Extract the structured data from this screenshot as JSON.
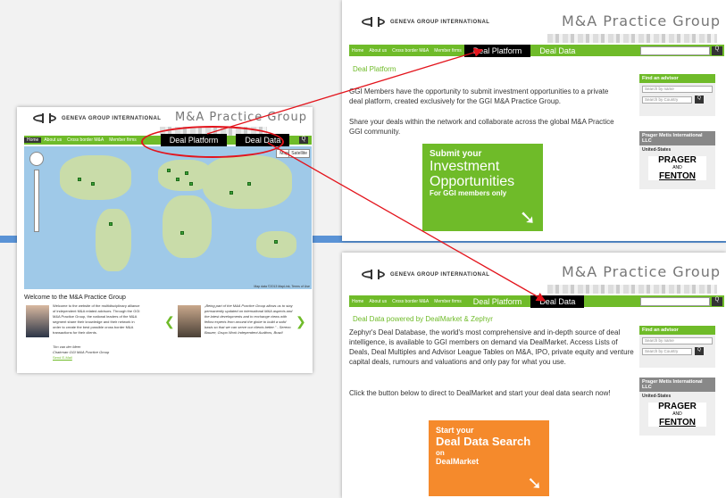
{
  "brand": {
    "logo_text": "GENEVA GROUP INTERNATIONAL",
    "site_title": "M&A Practice Group"
  },
  "nav": {
    "items": [
      "Home",
      "About us",
      "Cross border M&A",
      "Member firms"
    ],
    "deal_platform": "Deal Platform",
    "deal_data": "Deal Data",
    "map_tab": "Map",
    "satellite_tab": "Satellite"
  },
  "left": {
    "welcome_title": "Welcome to the M&A Practice Group",
    "welcome_body": "Welcome to the website of the multidisciplinary alliance of independent M&A related advisors. Through the GGI M&A Practice Group, the national leaders of the M&A segment share their knowledge and their network in order to create the best possible cross border M&A transactions for their clients.",
    "signer_name": "Tim van der Meer",
    "signer_role": "Chairman GGI M&A Practice Group",
    "signer_link": "Send E-Mail",
    "quote": "„Being part of the M&A Practice Group allows us to stay permanently updated on international M&A aspects and the latest developments and to exchange views with fellow experts from around the globe to build a solid basis so that we can serve our clients better.\" - Sereno Bauzer, Grupo Work Independent Auditors, Brazil",
    "prev": "❮",
    "next": "❯",
    "map_footer": "Map data ©2013 MapLink, Terms of Use"
  },
  "platform": {
    "title": "Deal Platform",
    "p1": "GGI Members have the opportunity to submit investment opportunities to a private deal platform, created exclusively for the GGI M&A Practice Group.",
    "p2": "Share your deals within the network and collaborate across the global M&A Practice GGI community.",
    "cta_l1": "Submit your",
    "cta_l2": "Investment",
    "cta_l3": "Opportunities",
    "cta_l4": "For GGI members only",
    "cta_arrow": "➘"
  },
  "data": {
    "title": "Deal Data powered by DealMarket & Zephyr",
    "p1": "Zephyr's Deal Database, the world's most comprehensive and in-depth source of deal intelligence, is available to GGI members on demand via DealMarket.  Access Lists of Deals, Deal Multiples and Advisor League Tables  on M&A, IPO, private equity and venture capital deals, rumours and valuations and only pay for what you use.",
    "p2": "Click the button below to direct to DealMarket and start your deal data search now!",
    "cta_l1": "Start your",
    "cta_l2": "Deal Data Search",
    "cta_l3": "on",
    "cta_l4": "DealMarket",
    "cta_arrow": "➘"
  },
  "sidebar": {
    "find_title": "Find an advisor",
    "search_placeholder": "Search by name",
    "country_select": "Search by Country",
    "go": "Q",
    "firm_title": "Prager Metis International LLC",
    "firm_country": "United-States",
    "firm_logo_1": "PRAGER",
    "firm_logo_2": "AND",
    "firm_logo_3": "FENTON"
  },
  "colors": {
    "green": "#6fbb29",
    "orange": "#f58a2c",
    "annotation": "#e3141c"
  }
}
